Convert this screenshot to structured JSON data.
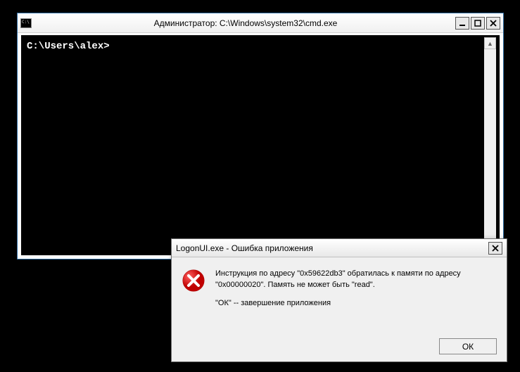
{
  "cmd": {
    "title": "Администратор: C:\\Windows\\system32\\cmd.exe",
    "prompt": "C:\\Users\\alex>"
  },
  "dialog": {
    "title": "LogonUI.exe - Ошибка приложения",
    "message_line1": "Инструкция по адресу \"0x59622db3\" обратилась к памяти по адресу \"0x00000020\". Память не может быть \"read\".",
    "message_line2": "\"ОК\" -- завершение приложения",
    "ok_label": "ОК"
  }
}
